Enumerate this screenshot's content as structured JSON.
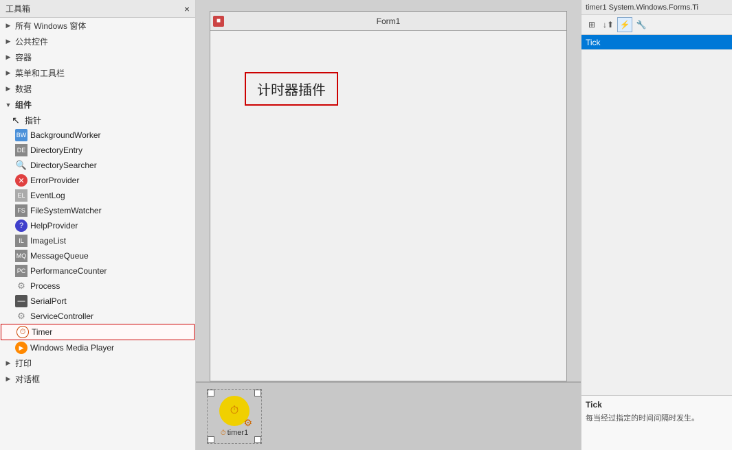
{
  "toolbox": {
    "title": "工具箱",
    "sections": [
      {
        "id": "all-windows",
        "label": "所有 Windows 窗体",
        "expanded": false,
        "arrow": "▶"
      },
      {
        "id": "common-controls",
        "label": "公共控件",
        "expanded": false,
        "arrow": "▶"
      },
      {
        "id": "containers",
        "label": "容器",
        "expanded": false,
        "arrow": "▶"
      },
      {
        "id": "menus-toolbars",
        "label": "菜单和工具栏",
        "expanded": false,
        "arrow": "▶"
      },
      {
        "id": "data",
        "label": "数据",
        "expanded": false,
        "arrow": "▶"
      },
      {
        "id": "components",
        "label": "组件",
        "expanded": true,
        "arrow": "▼"
      }
    ],
    "component_items": [
      {
        "id": "pointer",
        "label": "指针",
        "icon": "↖",
        "is_pointer": true
      },
      {
        "id": "background-worker",
        "label": "BackgroundWorker",
        "icon": "BW"
      },
      {
        "id": "directory-entry",
        "label": "DirectoryEntry",
        "icon": "DE"
      },
      {
        "id": "directory-searcher",
        "label": "DirectorySearcher",
        "icon": "🔍"
      },
      {
        "id": "error-provider",
        "label": "ErrorProvider",
        "icon": "✕"
      },
      {
        "id": "event-log",
        "label": "EventLog",
        "icon": "EL"
      },
      {
        "id": "fs-watcher",
        "label": "FileSystemWatcher",
        "icon": "FS"
      },
      {
        "id": "help-provider",
        "label": "HelpProvider",
        "icon": "?"
      },
      {
        "id": "image-list",
        "label": "ImageList",
        "icon": "IL"
      },
      {
        "id": "message-queue",
        "label": "MessageQueue",
        "icon": "MQ"
      },
      {
        "id": "perf-counter",
        "label": "PerformanceCounter",
        "icon": "PC"
      },
      {
        "id": "process",
        "label": "Process",
        "icon": "⚙"
      },
      {
        "id": "serial-port",
        "label": "SerialPort",
        "icon": "—"
      },
      {
        "id": "service-controller",
        "label": "ServiceController",
        "icon": "⚙"
      },
      {
        "id": "timer",
        "label": "Timer",
        "icon": "⏱",
        "highlighted": true
      },
      {
        "id": "wmp",
        "label": "Windows Media Player",
        "icon": "▶"
      }
    ],
    "bottom_sections": [
      {
        "id": "print",
        "label": "打印",
        "arrow": "▶"
      },
      {
        "id": "dialogs",
        "label": "对话框",
        "arrow": "▶"
      }
    ]
  },
  "designer": {
    "form_title": "Form1",
    "annotation_text": "计时器插件",
    "timer_label": "timer1",
    "component_tray_label": "timer1"
  },
  "properties": {
    "header_text": "timer1  System.Windows.Forms.Ti",
    "toolbar_buttons": [
      {
        "icon": "⊞",
        "label": "categorized"
      },
      {
        "icon": "↓",
        "label": "sort"
      },
      {
        "icon": "⚡",
        "label": "events"
      },
      {
        "icon": "🔧",
        "label": "settings"
      }
    ],
    "items": [
      {
        "name": "Tick",
        "selected": true
      }
    ],
    "bottom_title": "Tick",
    "bottom_desc": "每当经过指定的时间间隔时发生。"
  }
}
